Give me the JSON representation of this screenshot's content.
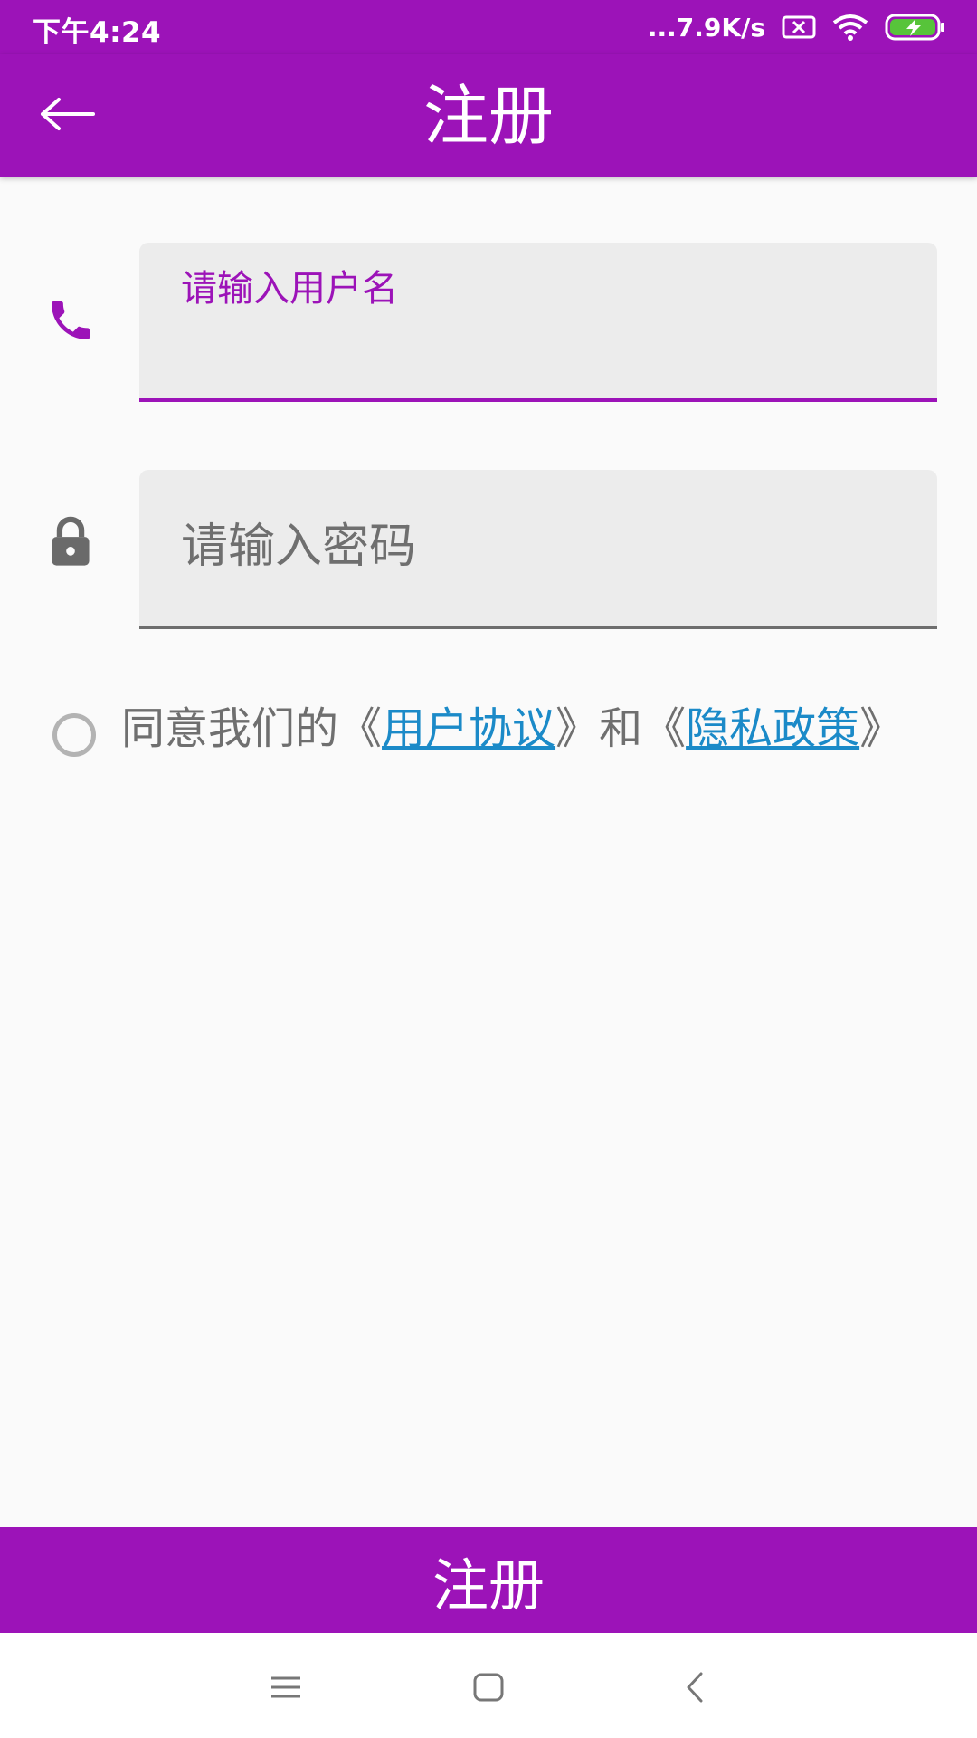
{
  "status_bar": {
    "time": "下午4:24",
    "network_speed": "...7.9K/s",
    "icons": [
      "sim-disabled-icon",
      "wifi-icon",
      "battery-charging-icon"
    ]
  },
  "app_bar": {
    "title": "注册",
    "back_icon": "arrow-left-icon"
  },
  "form": {
    "username": {
      "label": "请输入用户名",
      "value": "",
      "icon": "phone-icon"
    },
    "password": {
      "placeholder": "请输入密码",
      "value": "",
      "icon": "lock-icon"
    }
  },
  "agreement": {
    "checked": false,
    "prefix": "同意我们的",
    "open_quote": "《",
    "close_quote": "》",
    "user_agreement": "用户协议",
    "conjunction": "和",
    "privacy_policy": "隐私政策"
  },
  "register_button": {
    "label": "注册"
  },
  "nav_bar": {
    "icons": [
      "menu-icon",
      "home-icon",
      "back-icon"
    ]
  },
  "colors": {
    "primary": "#9c13b8",
    "link": "#1b8ac8",
    "field_bg": "#ececec",
    "page_bg": "#fafafa"
  }
}
